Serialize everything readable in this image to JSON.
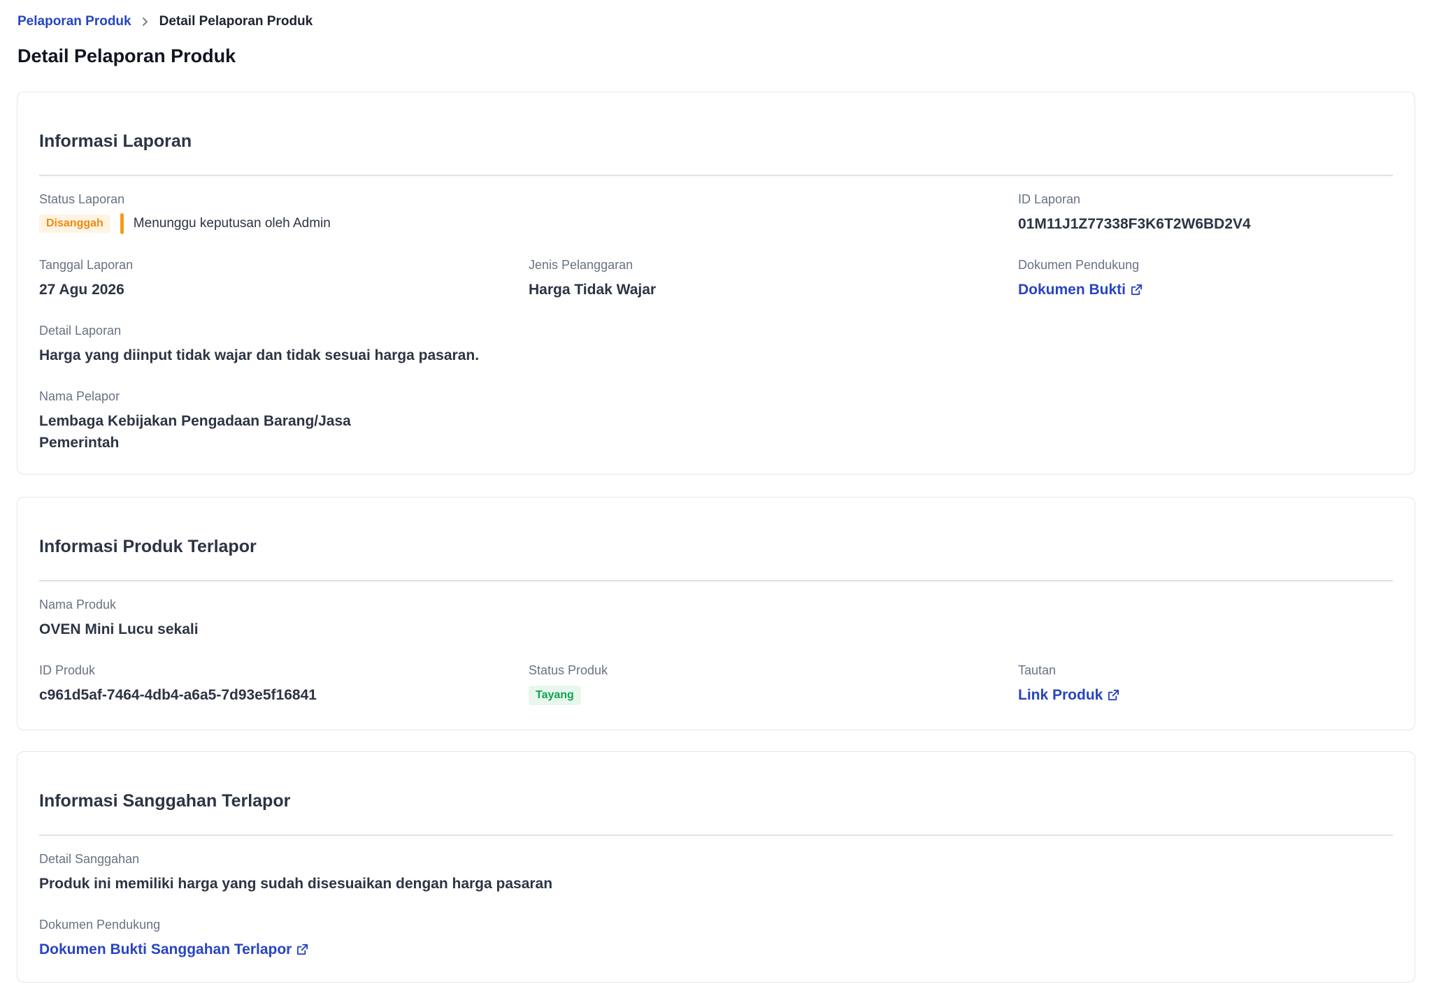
{
  "breadcrumb": {
    "parent": "Pelaporan Produk",
    "current": "Detail Pelaporan Produk"
  },
  "page_title": "Detail Pelaporan Produk",
  "informasi_laporan": {
    "title": "Informasi Laporan",
    "status_label": "Status Laporan",
    "status_badge": "Disanggah",
    "status_note": "Menunggu keputusan oleh Admin",
    "id_label": "ID Laporan",
    "id_value": "01M11J1Z77338F3K6T2W6BD2V4",
    "tanggal_label": "Tanggal Laporan",
    "tanggal_value": "27 Agu 2026",
    "jenis_label": "Jenis Pelanggaran",
    "jenis_value": "Harga Tidak Wajar",
    "dokumen_label": "Dokumen Pendukung",
    "dokumen_link": "Dokumen Bukti",
    "detail_label": "Detail Laporan",
    "detail_value": "Harga yang diinput tidak wajar dan tidak sesuai harga pasaran.",
    "pelapor_label": "Nama Pelapor",
    "pelapor_value_line1": "Lembaga Kebijakan Pengadaan Barang/Jasa",
    "pelapor_value_line2": "Pemerintah"
  },
  "informasi_produk": {
    "title": "Informasi Produk Terlapor",
    "nama_label": "Nama Produk",
    "nama_value": "OVEN Mini Lucu sekali",
    "id_label": "ID Produk",
    "id_value": "c961d5af-7464-4db4-a6a5-7d93e5f16841",
    "status_label": "Status Produk",
    "status_badge": "Tayang",
    "tautan_label": "Tautan",
    "tautan_link": "Link Produk"
  },
  "informasi_sanggahan": {
    "title": "Informasi Sanggahan Terlapor",
    "detail_label": "Detail Sanggahan",
    "detail_value": "Produk ini memiliki harga yang sudah disesuaikan dengan harga pasaran",
    "dokumen_label": "Dokumen Pendukung",
    "dokumen_link": "Dokumen Bukti Sanggahan Terlapor"
  },
  "colors": {
    "link": "#2744c3",
    "text": "#2c3444",
    "muted": "#687283",
    "warning": "#f08a0b",
    "success": "#12a150",
    "border": "#e3e6ec"
  },
  "icons": {
    "breadcrumb_separator": "chevron-right-icon",
    "external_link": "external-link-icon"
  }
}
